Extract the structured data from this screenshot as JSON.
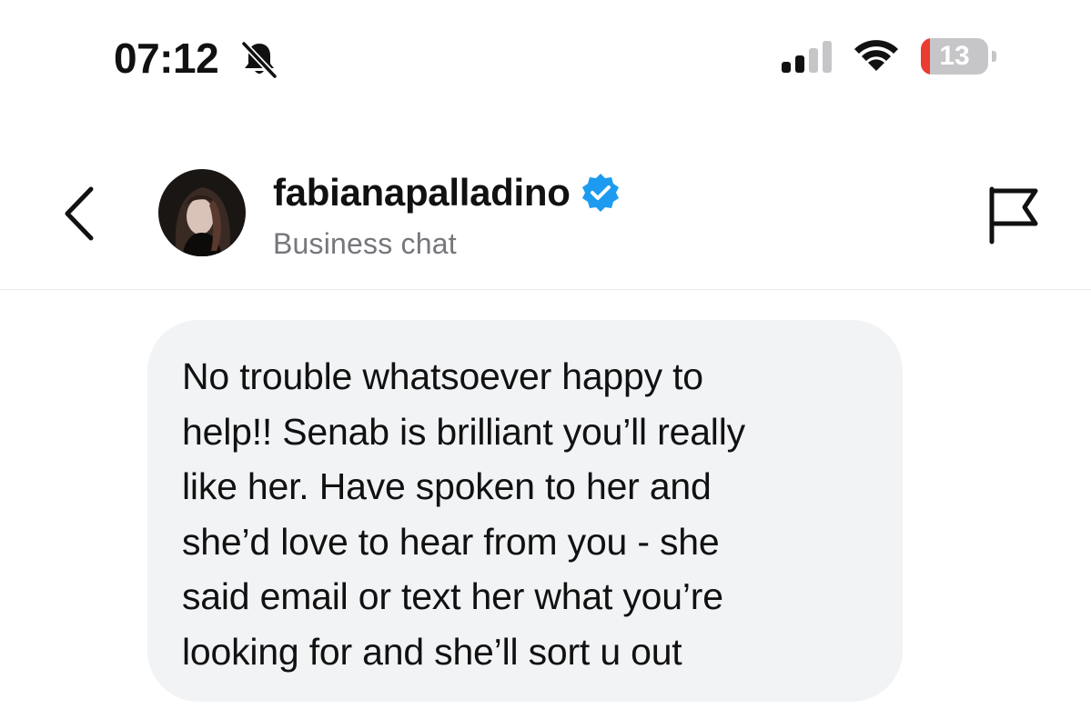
{
  "status_bar": {
    "time": "07:12",
    "silent_icon": "bell-slash-icon",
    "signal_icon": "cellular-signal-icon",
    "signal_bars_active": 2,
    "signal_bars_total": 4,
    "wifi_icon": "wifi-icon",
    "battery_icon": "battery-icon",
    "battery_level": "13",
    "battery_fraction": 0.13,
    "battery_low_color": "#ec3b32"
  },
  "header": {
    "back_icon": "chevron-left-icon",
    "username": "fabianapalladino",
    "verified_icon": "verified-badge-icon",
    "verified_color": "#1d9bf0",
    "subtitle": "Business chat",
    "report_icon": "flag-icon"
  },
  "messages": [
    {
      "text": "No trouble whatsoever happy to\nhelp!! Senab is brilliant you’ll really\nlike her. Have spoken to her and\nshe’d love to hear from you - she\nsaid email or text her what you’re\nlooking for and she’ll sort u out"
    }
  ]
}
